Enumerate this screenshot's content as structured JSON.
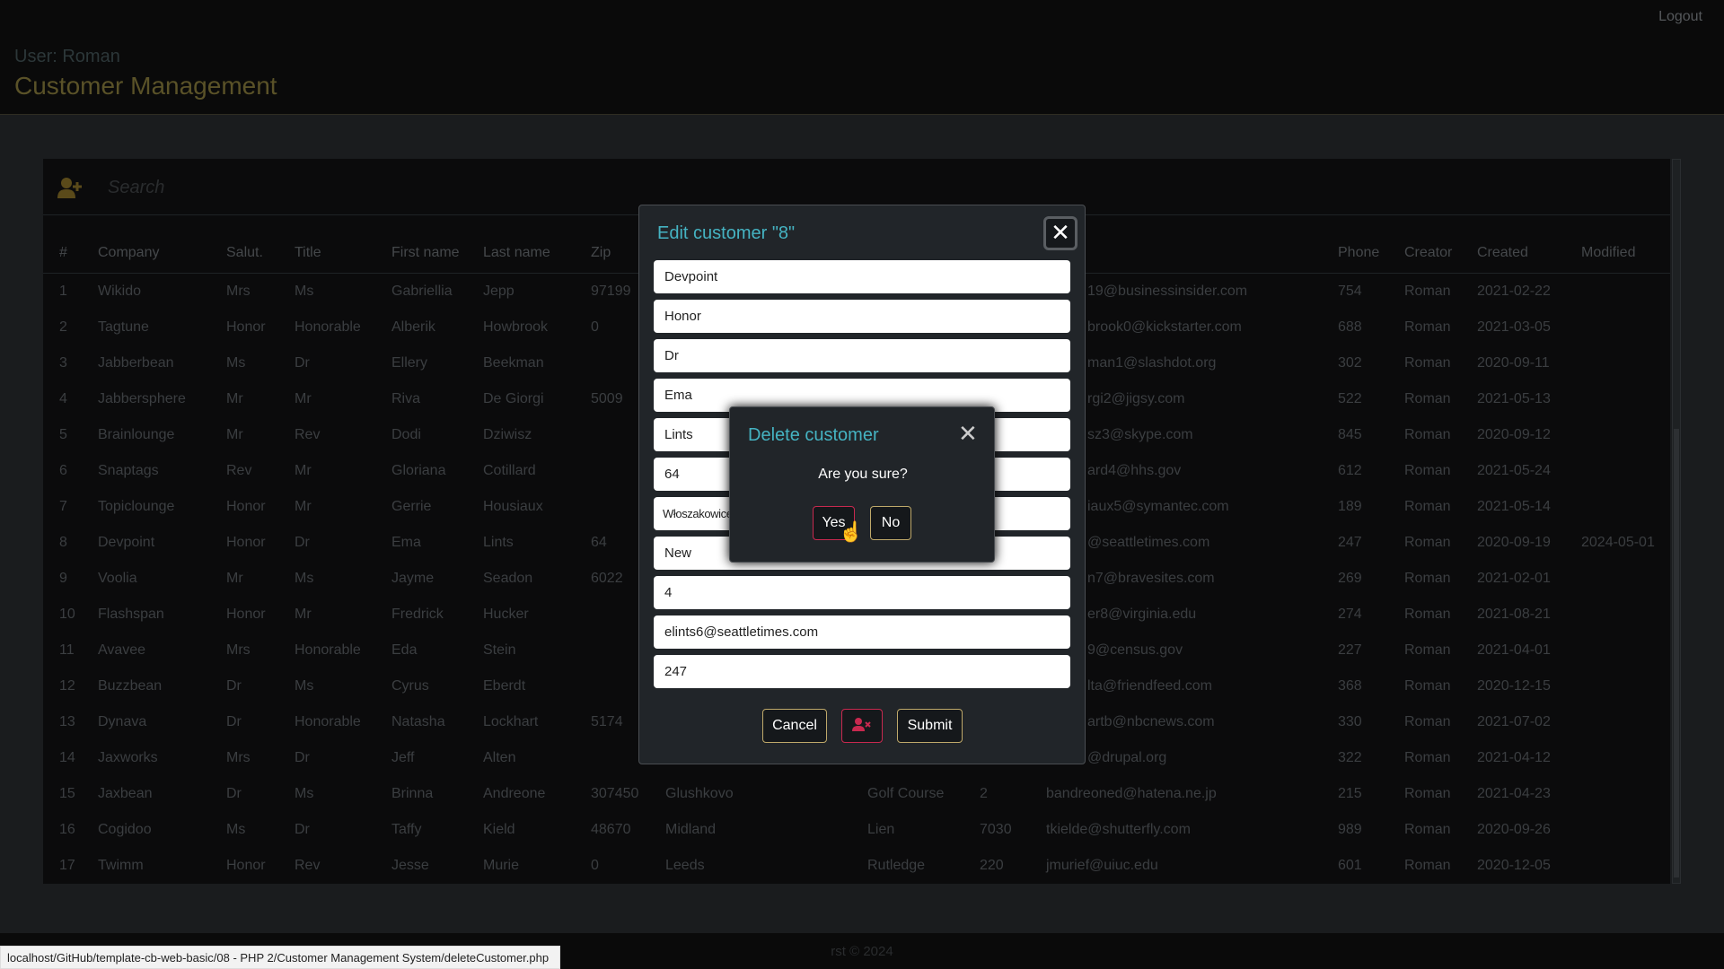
{
  "header": {
    "user": "User: Roman",
    "title": "Customer Management",
    "logout": "Logout"
  },
  "search": {
    "placeholder": "Search"
  },
  "table": {
    "columns": [
      "#",
      "Company",
      "Salut.",
      "Title",
      "First name",
      "Last name",
      "Zip",
      "",
      "",
      "",
      "",
      "Phone",
      "Creator",
      "Created",
      "Modified"
    ],
    "rows": [
      [
        "1",
        "Wikido",
        "Mrs",
        "Ms",
        "Gabriellia",
        "Jepp",
        "97199",
        "",
        "",
        "",
        "19@businessinsider.com",
        "754",
        "Roman",
        "2021-02-22",
        ""
      ],
      [
        "2",
        "Tagtune",
        "Honor",
        "Honorable",
        "Alberik",
        "Howbrook",
        "0",
        "",
        "",
        "",
        "brook0@kickstarter.com",
        "688",
        "Roman",
        "2021-03-05",
        ""
      ],
      [
        "3",
        "Jabberbean",
        "Ms",
        "Dr",
        "Ellery",
        "Beekman",
        "",
        "",
        "",
        "",
        "man1@slashdot.org",
        "302",
        "Roman",
        "2020-09-11",
        ""
      ],
      [
        "4",
        "Jabbersphere",
        "Mr",
        "Mr",
        "Riva",
        "De Giorgi",
        "5009",
        "",
        "",
        "",
        "rgi2@jigsy.com",
        "522",
        "Roman",
        "2021-05-13",
        ""
      ],
      [
        "5",
        "Brainlounge",
        "Mr",
        "Rev",
        "Dodi",
        "Dziwisz",
        "",
        "",
        "",
        "",
        "sz3@skype.com",
        "845",
        "Roman",
        "2020-09-12",
        ""
      ],
      [
        "6",
        "Snaptags",
        "Rev",
        "Mr",
        "Gloriana",
        "Cotillard",
        "",
        "",
        "",
        "",
        "ard4@hhs.gov",
        "612",
        "Roman",
        "2021-05-24",
        ""
      ],
      [
        "7",
        "Topiclounge",
        "Honor",
        "Mr",
        "Gerrie",
        "Housiaux",
        "",
        "",
        "",
        "",
        "iaux5@symantec.com",
        "189",
        "Roman",
        "2021-05-14",
        ""
      ],
      [
        "8",
        "Devpoint",
        "Honor",
        "Dr",
        "Ema",
        "Lints",
        "64",
        "",
        "",
        "",
        "@seattletimes.com",
        "247",
        "Roman",
        "2020-09-19",
        "2024-05-01"
      ],
      [
        "9",
        "Voolia",
        "Mr",
        "Ms",
        "Jayme",
        "Seadon",
        "6022",
        "",
        "",
        "",
        "n7@bravesites.com",
        "269",
        "Roman",
        "2021-02-01",
        ""
      ],
      [
        "10",
        "Flashspan",
        "Honor",
        "Mr",
        "Fredrick",
        "Hucker",
        "",
        "",
        "",
        "",
        "er8@virginia.edu",
        "274",
        "Roman",
        "2021-08-21",
        ""
      ],
      [
        "11",
        "Avavee",
        "Mrs",
        "Honorable",
        "Eda",
        "Stein",
        "",
        "",
        "",
        "",
        "9@census.gov",
        "227",
        "Roman",
        "2021-04-01",
        ""
      ],
      [
        "12",
        "Buzzbean",
        "Dr",
        "Ms",
        "Cyrus",
        "Eberdt",
        "",
        "",
        "",
        "",
        "lta@friendfeed.com",
        "368",
        "Roman",
        "2020-12-15",
        ""
      ],
      [
        "13",
        "Dynava",
        "Dr",
        "Honorable",
        "Natasha",
        "Lockhart",
        "5174",
        "",
        "",
        "",
        "artb@nbcnews.com",
        "330",
        "Roman",
        "2021-07-02",
        ""
      ],
      [
        "14",
        "Jaxworks",
        "Mrs",
        "Dr",
        "Jeff",
        "Alten",
        "",
        "",
        "",
        "",
        "@drupal.org",
        "322",
        "Roman",
        "2021-04-12",
        ""
      ],
      [
        "15",
        "Jaxbean",
        "Dr",
        "Ms",
        "Brinna",
        "Andreone",
        "307450",
        "Glushkovo",
        "Golf Course",
        "2",
        "bandreoned@hatena.ne.jp",
        "215",
        "Roman",
        "2021-04-23",
        ""
      ],
      [
        "16",
        "Cogidoo",
        "Ms",
        "Dr",
        "Taffy",
        "Kield",
        "48670",
        "Midland",
        "Lien",
        "7030",
        "tkielde@shutterfly.com",
        "989",
        "Roman",
        "2020-09-26",
        ""
      ],
      [
        "17",
        "Twimm",
        "Honor",
        "Rev",
        "Jesse",
        "Murie",
        "0",
        "Leeds",
        "Rutledge",
        "220",
        "jmurief@uiuc.edu",
        "601",
        "Roman",
        "2020-12-05",
        ""
      ]
    ]
  },
  "edit_modal": {
    "title": "Edit customer \"8\"",
    "fields": [
      "Devpoint",
      "Honor",
      "Dr",
      "Ema",
      "Lints",
      "64",
      "Włoszakowice",
      "New",
      "4",
      "elints6@seattletimes.com",
      "247"
    ],
    "cancel": "Cancel",
    "submit": "Submit",
    "delete_icon": "user-x-icon"
  },
  "delete_modal": {
    "title": "Delete customer",
    "message": "Are you sure?",
    "yes": "Yes",
    "no": "No"
  },
  "footer": {
    "copyright": "rst © 2024"
  },
  "status_url": "localhost/GitHub/template-cb-web-basic/08 - PHP 2/Customer Management System/deleteCustomer.php",
  "colors": {
    "accent": "#45b3c2",
    "title": "#5a5228",
    "danger": "#c8294f",
    "button_border": "#bfa96a"
  }
}
